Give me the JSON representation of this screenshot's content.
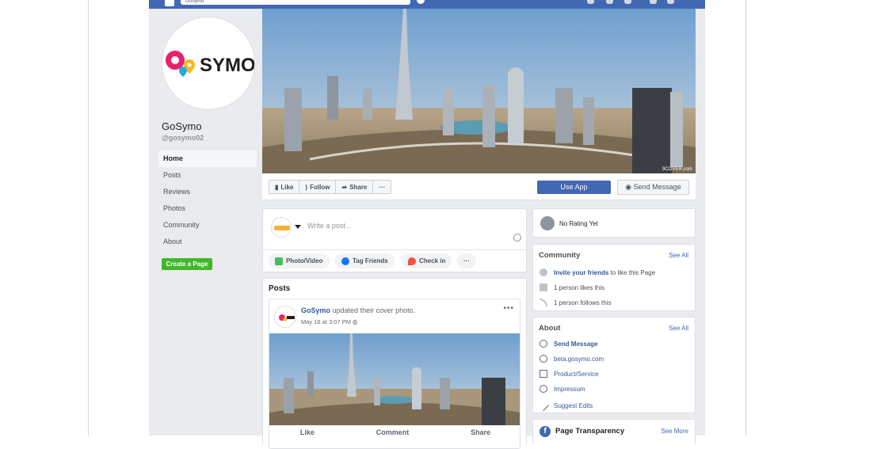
{
  "topbar": {
    "search_value": "GoSymo"
  },
  "logo": {
    "text": "SYMO"
  },
  "page": {
    "name": "GoSymo",
    "handle": "@gosymo02"
  },
  "nav": {
    "items": [
      "Home",
      "Posts",
      "Reviews",
      "Photos",
      "Community",
      "About"
    ]
  },
  "create_page_label": "Create a Page",
  "cover": {
    "watermark": "9COVER.com"
  },
  "actionbar": {
    "like": "Like",
    "follow": "Follow",
    "share": "Share",
    "more": "···",
    "use_app": "Use App",
    "send_message": "Send Message"
  },
  "composer": {
    "placeholder": "Write a post...",
    "photo_video": "Photo/Video",
    "tag_friends": "Tag Friends",
    "check_in": "Check in",
    "more": "···"
  },
  "posts": {
    "title": "Posts",
    "post": {
      "author": "GoSymo",
      "action": "updated their cover photo.",
      "time": "May 16 at 3:07 PM",
      "like": "Like",
      "comment": "Comment",
      "share": "Share"
    }
  },
  "rating": {
    "text": "No Rating Yet"
  },
  "community": {
    "title": "Community",
    "see_all": "See All",
    "invite_link": "Invite your friends",
    "invite_rest": "to like this Page",
    "likes": "1 person likes this",
    "follows": "1 person follows this"
  },
  "about": {
    "title": "About",
    "see_all": "See All",
    "send_message": "Send Message",
    "website": "beta.gosymo.com",
    "category": "Product/Service",
    "impressum": "Impressum",
    "suggest_edits": "Suggest Edits"
  },
  "transparency": {
    "title": "Page Transparency",
    "see_more": "See More"
  },
  "colors": {
    "brand_blue": "#4267b2",
    "green": "#42b72a",
    "background": "#e9ebee"
  }
}
